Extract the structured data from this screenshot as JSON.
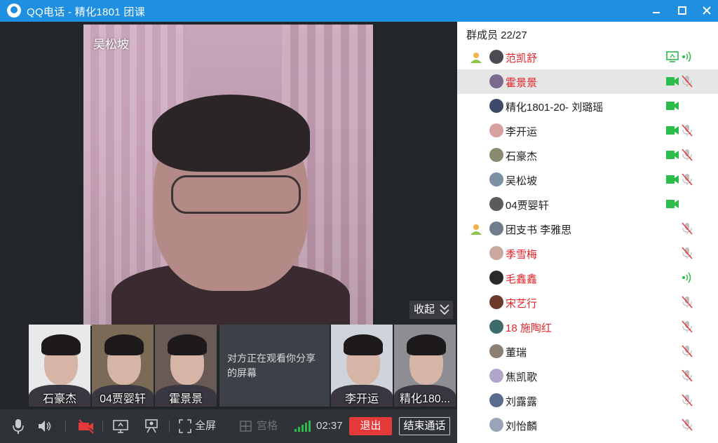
{
  "window": {
    "title": "QQ电话 - 精化1801  团课",
    "minimize": "—",
    "maximize": "□",
    "close": "✕"
  },
  "main_video": {
    "name": "吴松坡"
  },
  "collapse_label": "收起",
  "thumbnails": [
    {
      "name": "石豪杰",
      "bg": "#e9e8ea"
    },
    {
      "name": "04贾婴轩",
      "bg": "#7b6a55"
    },
    {
      "name": "霍景景",
      "bg": "#6a5a56"
    },
    {
      "name": "李开运",
      "bg": "#cfd3dc"
    },
    {
      "name": "精化180...",
      "bg": "#8c8e94"
    }
  ],
  "share_notice": "对方正在观看你分享的屏幕",
  "toolbar": {
    "fullscreen": "全屏",
    "grid": "宫格",
    "timer": "02:37",
    "exit": "退出",
    "end_call": "结束通话"
  },
  "panel": {
    "member_count": "群成员 22/27",
    "members": [
      {
        "name": "范凯舒",
        "red": true,
        "admin": true,
        "cam": false,
        "screen": true,
        "mic": "speaking"
      },
      {
        "name": "霍景景",
        "red": true,
        "admin": false,
        "cam": true,
        "screen": false,
        "mic": "muted",
        "selected": true
      },
      {
        "name": "精化1801-20- 刘璐瑶",
        "red": false,
        "admin": false,
        "cam": true,
        "screen": false,
        "mic": "none"
      },
      {
        "name": "李开运",
        "red": false,
        "admin": false,
        "cam": true,
        "screen": false,
        "mic": "muted"
      },
      {
        "name": "石豪杰",
        "red": false,
        "admin": false,
        "cam": true,
        "screen": false,
        "mic": "muted"
      },
      {
        "name": "吴松坡",
        "red": false,
        "admin": false,
        "cam": true,
        "screen": false,
        "mic": "muted"
      },
      {
        "name": "04贾婴轩",
        "red": false,
        "admin": false,
        "cam": true,
        "screen": false,
        "mic": "none"
      },
      {
        "name": "团支书  李雅思",
        "red": false,
        "admin": true,
        "cam": false,
        "screen": false,
        "mic": "muted"
      },
      {
        "name": "季雪梅",
        "red": true,
        "admin": false,
        "cam": false,
        "screen": false,
        "mic": "muted"
      },
      {
        "name": "毛鑫鑫",
        "red": true,
        "admin": false,
        "cam": false,
        "screen": false,
        "mic": "speaking"
      },
      {
        "name": "宋艺行",
        "red": true,
        "admin": false,
        "cam": false,
        "screen": false,
        "mic": "muted"
      },
      {
        "name": "18    施陶红",
        "red": true,
        "admin": false,
        "cam": false,
        "screen": false,
        "mic": "muted"
      },
      {
        "name": "董瑞",
        "red": false,
        "admin": false,
        "cam": false,
        "screen": false,
        "mic": "muted"
      },
      {
        "name": "焦凯歌",
        "red": false,
        "admin": false,
        "cam": false,
        "screen": false,
        "mic": "muted"
      },
      {
        "name": "刘露露",
        "red": false,
        "admin": false,
        "cam": false,
        "screen": false,
        "mic": "muted"
      },
      {
        "name": "刘怡麟",
        "red": false,
        "admin": false,
        "cam": false,
        "screen": false,
        "mic": "muted"
      }
    ]
  },
  "colors": {
    "accent": "#1e8fe1",
    "danger": "#e5393a",
    "camera_on": "#2dbb49",
    "name_red": "#e4242b"
  }
}
